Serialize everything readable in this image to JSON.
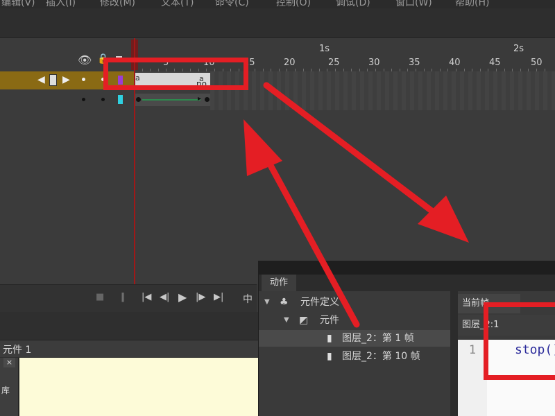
{
  "menubar": {
    "items": [
      "编辑(V)",
      "插入(I)",
      "修改(M)",
      "文本(T)",
      "命令(C)",
      "控制(O)",
      "调试(D)",
      "窗口(W)",
      "帮助(H)"
    ]
  },
  "timeline": {
    "seconds": [
      "1s",
      "2s"
    ],
    "ticks": [
      "5",
      "10",
      "15",
      "20",
      "25",
      "30",
      "35",
      "40",
      "45",
      "50"
    ],
    "layer1": {
      "keyframe_label": "no",
      "keyframe_marker": "a"
    },
    "layer2": {},
    "playhead_frame": 1
  },
  "controls": {
    "camera_icon": "camera-icon",
    "buttons": [
      "first-frame-icon",
      "prev-frame-icon",
      "play-icon",
      "next-frame-icon",
      "last-frame-icon",
      "center-frame-icon"
    ],
    "center_label": "中"
  },
  "library": {
    "tab_label": "元件 1",
    "close": "×",
    "side_text": "库"
  },
  "actions": {
    "tab": "动作",
    "tree": [
      {
        "label": "元件定义",
        "depth": 0
      },
      {
        "label": "元件",
        "depth": 1
      },
      {
        "label": "图层_2：第 1 帧",
        "depth": 2
      },
      {
        "label": "图层_2：第 10 帧",
        "depth": 2
      }
    ],
    "script_tab": "当前帧",
    "script_path": "图层_2:1",
    "line_number": "1",
    "code": "stop();"
  },
  "colors": {
    "highlight": "#e41e24",
    "layer_active": "#8a6a14",
    "playhead": "#a11818"
  }
}
